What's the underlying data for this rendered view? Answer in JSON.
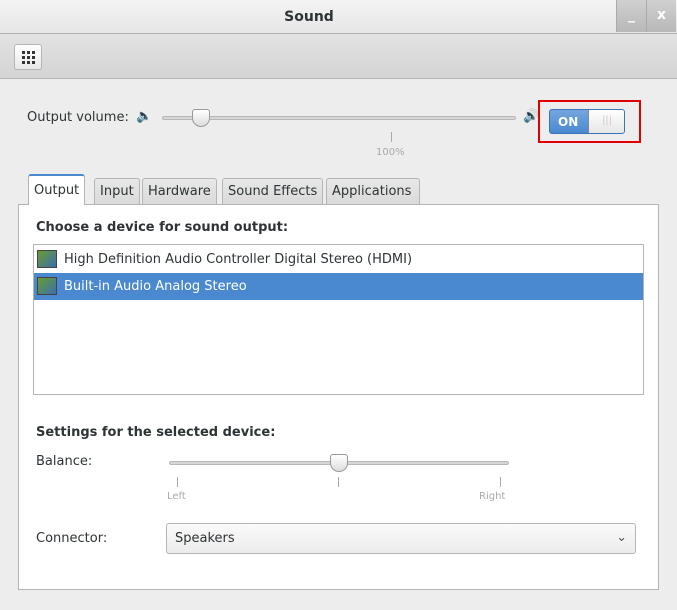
{
  "window": {
    "title": "Sound",
    "minimize_icon": "_",
    "close_icon": "x"
  },
  "toolbar": {
    "apps_icon": "grid-icon"
  },
  "volume": {
    "label": "Output volume:",
    "level_percent": 15,
    "mark_label": "100%",
    "switch_label": "ON",
    "switch_on": true
  },
  "tabs": [
    {
      "label": "Output",
      "active": true
    },
    {
      "label": "Input"
    },
    {
      "label": "Hardware"
    },
    {
      "label": "Sound Effects"
    },
    {
      "label": "Applications"
    }
  ],
  "output": {
    "choose_label": "Choose a device for sound output:",
    "devices": [
      {
        "name": "High Definition Audio Controller Digital Stereo (HDMI)",
        "selected": false
      },
      {
        "name": "Built-in Audio Analog Stereo",
        "selected": true
      }
    ],
    "settings_label": "Settings for the selected device:",
    "balance_label": "Balance:",
    "balance_value": 0,
    "balance_left": "Left",
    "balance_right": "Right",
    "connector_label": "Connector:",
    "connector_value": "Speakers"
  }
}
